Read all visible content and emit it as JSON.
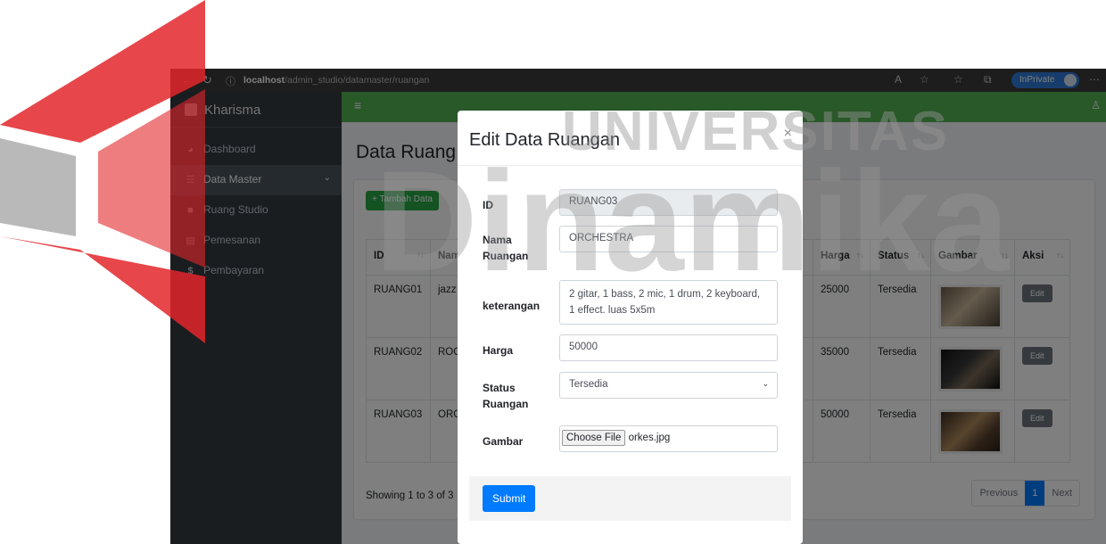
{
  "browser": {
    "url_host": "localhost",
    "url_path": "/admin_studio/datamaster/ruangan",
    "inprivate_label": "InPrivate"
  },
  "watermark": {
    "text_1": "UNIVERSITAS",
    "text_2": "Dinamika",
    "colors": {
      "red": "#e3262b",
      "grey": "#9b9b9b"
    }
  },
  "sidebar": {
    "brand": "Kharisma",
    "items": [
      {
        "label": "Dashboard",
        "icon": "tachometer-icon"
      },
      {
        "label": "Data Master",
        "icon": "database-icon"
      },
      {
        "label": "Ruang Studio",
        "icon": "room-icon"
      },
      {
        "label": "Pemesanan",
        "icon": "clipboard-icon"
      },
      {
        "label": "Pembayaran",
        "icon": "dollar-icon"
      }
    ]
  },
  "main": {
    "page_title": "Data Ruang S",
    "add_button": "Tambah Data",
    "columns": [
      "ID",
      "Nam",
      "Harga",
      "Status",
      "Gambar",
      "Aksi"
    ],
    "rows": [
      {
        "id": "RUANG01",
        "name": "jazz",
        "harga": "25000",
        "status": "Tersedia",
        "aksi": "Edit"
      },
      {
        "id": "RUANG02",
        "name": "ROC",
        "harga": "35000",
        "status": "Tersedia",
        "aksi": "Edit"
      },
      {
        "id": "RUANG03",
        "name": "ORC",
        "harga": "50000",
        "status": "Tersedia",
        "aksi": "Edit"
      }
    ],
    "showing_text": "Showing 1 to 3 of 3",
    "pagination": {
      "previous": "Previous",
      "current": "1",
      "next": "Next"
    }
  },
  "modal": {
    "title": "Edit Data Ruangan",
    "close": "×",
    "fields": {
      "id_label": "ID",
      "id_value": "RUANG03",
      "nama_label_1": "Nama",
      "nama_label_2": "Ruangan",
      "nama_value": "ORCHESTRA",
      "keterangan_label": "keterangan",
      "keterangan_value": "2 gitar, 1 bass, 2 mic, 1 drum, 2 keyboard, 1 effect. luas 5x5m",
      "harga_label": "Harga",
      "harga_value": "50000",
      "status_label_1": "Status",
      "status_label_2": "Ruangan",
      "status_value": "Tersedia",
      "gambar_label": "Gambar",
      "gambar_button": "Choose File",
      "gambar_filename": "orkes.jpg"
    },
    "submit": "Submit"
  },
  "colors": {
    "topnav": "#52b152",
    "sidebar": "#343a40",
    "primary": "#007bff",
    "success": "#28a745"
  }
}
